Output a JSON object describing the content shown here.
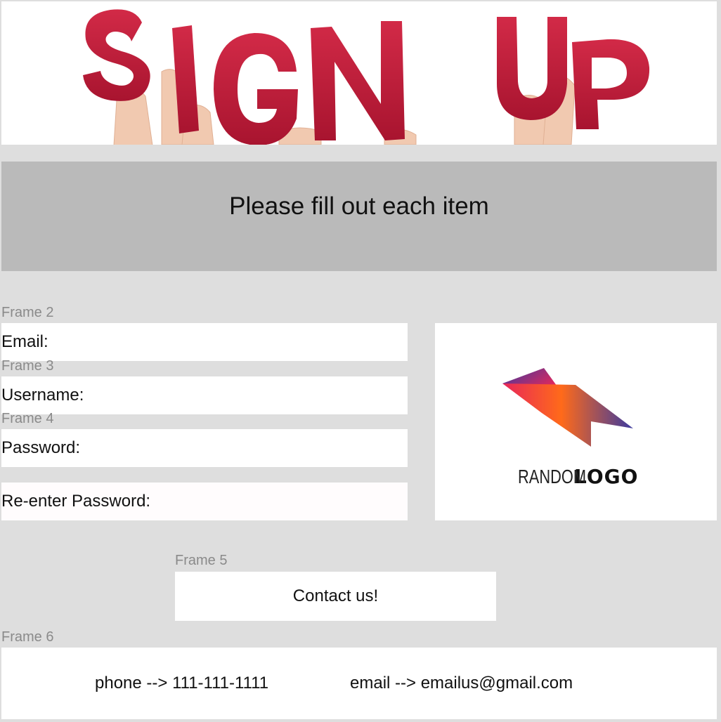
{
  "banner": {
    "text": "SIGN UP",
    "color": "#c21b3a"
  },
  "header": {
    "text": "Please fill out each item"
  },
  "frames": {
    "frame2": "Frame 2",
    "frame3": "Frame 3",
    "frame4": "Frame 4",
    "frame5": "Frame 5",
    "frame6": "Frame 6"
  },
  "form": {
    "email_label": "Email:",
    "username_label": "Username:",
    "password_label": "Password:",
    "reenter_password_label": "Re-enter Password:"
  },
  "logo": {
    "word1": "RANDOM",
    "word2": "LOGO",
    "gradient_start": "#ff6a1a",
    "gradient_mid": "#e8265a",
    "gradient_end": "#3b3aa0"
  },
  "contact": {
    "button_label": "Contact us!"
  },
  "footer": {
    "phone": "phone --> 111-111-1111",
    "email": "email --> emailus@gmail.com"
  }
}
